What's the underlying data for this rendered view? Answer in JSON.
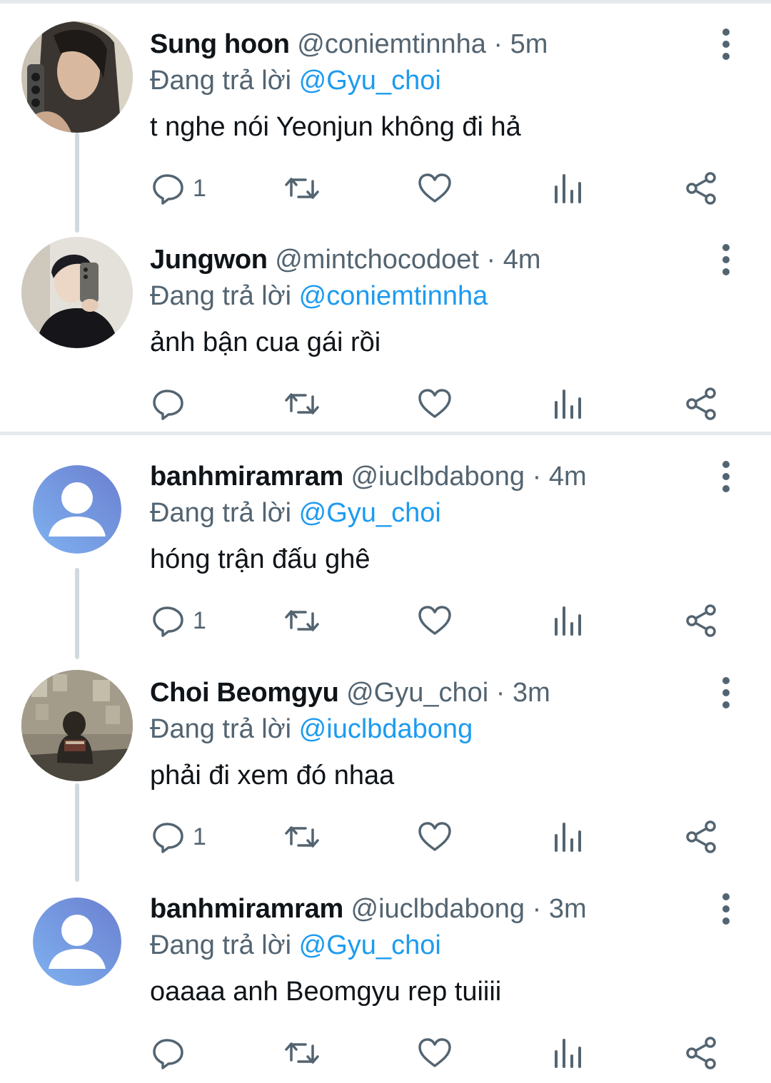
{
  "tweets": [
    {
      "name": "Sung hoon",
      "handle": "@coniemtinnha",
      "time": "5m",
      "reply_prefix": "Đang trả lời",
      "reply_to": "@Gyu_choi",
      "text": "t nghe nói Yeonjun không đi hả",
      "reply_count": "1"
    },
    {
      "name": "Jungwon",
      "handle": "@mintchocodoet",
      "time": "4m",
      "reply_prefix": "Đang trả lời",
      "reply_to": "@coniemtinnha",
      "text": "ảnh bận cua gái rồi",
      "reply_count": ""
    },
    {
      "name": "banhmiramram",
      "handle": "@iuclbdabong",
      "time": "4m",
      "reply_prefix": "Đang trả lời",
      "reply_to": "@Gyu_choi",
      "text": "hóng trận đấu ghê",
      "reply_count": "1"
    },
    {
      "name": "Choi Beomgyu",
      "handle": "@Gyu_choi",
      "time": "3m",
      "reply_prefix": "Đang trả lời",
      "reply_to": "@iuclbdabong",
      "text": "phải đi xem đó nhaa",
      "reply_count": "1"
    },
    {
      "name": "banhmiramram",
      "handle": "@iuclbdabong",
      "time": "3m",
      "reply_prefix": "Đang trả lời",
      "reply_to": "@Gyu_choi",
      "text": "oaaaa anh Beomgyu rep tuiiii",
      "reply_count": ""
    }
  ],
  "separator": "·",
  "icons": {
    "reply": "reply-icon",
    "retweet": "retweet-icon",
    "like": "like-icon",
    "views": "views-icon",
    "share": "share-icon",
    "more": "more-vertical-icon"
  },
  "colors": {
    "text": "#0f1419",
    "muted": "#536471",
    "link": "#1d9bf0",
    "divider": "#e6e9ec",
    "thread_line": "#cfd9de"
  }
}
